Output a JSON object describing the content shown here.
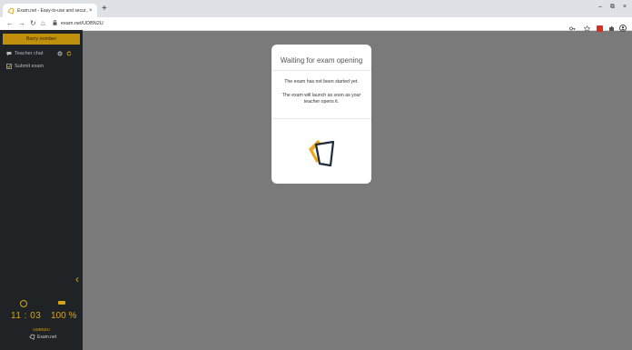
{
  "browser": {
    "tab_title": "Exam.net - Easy-to-use and secur...",
    "tab_close": "×",
    "new_tab": "+",
    "url": "exam.net/UDBN2U",
    "window_controls": [
      "–",
      "⧉",
      "×"
    ]
  },
  "sidebar": {
    "student_name": "Barry nomber",
    "items": [
      {
        "label": "Teacher chat",
        "icon": "chat-icon"
      },
      {
        "label": "Submit exam",
        "icon": "checkbox-icon"
      }
    ],
    "collapse_glyph": "‹",
    "time": "11 : 03",
    "battery": "100 %",
    "exam_code": "UDBN2U",
    "brand": "Exam.net"
  },
  "modal": {
    "title": "Waiting for exam opening",
    "line1": "The exam has not been started yet.",
    "line2": "The exam will launch as soon as your teacher opens it."
  },
  "colors": {
    "accent": "#d9a514",
    "sidebar_bg": "#1f2326",
    "page_bg": "#7a7a7a"
  }
}
